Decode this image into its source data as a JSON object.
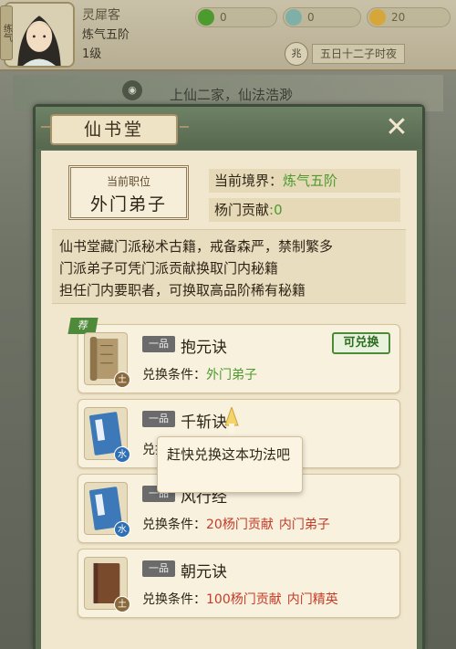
{
  "top_bar": {
    "side_tab": "练气",
    "player": {
      "name": "灵犀客",
      "realm": "炼气五阶",
      "level": "1级"
    },
    "resources": [
      {
        "icon": "spirit-stone-icon",
        "value": "0"
      },
      {
        "icon": "jade-icon",
        "value": "0"
      },
      {
        "icon": "coin-icon",
        "value": "20"
      }
    ],
    "time_badge": "兆",
    "time_text": "五日十二子时夜"
  },
  "news": {
    "text": "上仙二家，仙法浩渺"
  },
  "panel": {
    "title": "仙书堂",
    "close_icon": "close-icon",
    "rank": {
      "label": "当前职位",
      "value": "外门弟子"
    },
    "realm": {
      "label": "当前境界：",
      "value": "炼气五阶"
    },
    "contribution": {
      "label": "杨门贡献",
      "value": ":0"
    },
    "description": [
      "仙书堂藏门派秘术古籍，戒备森严，禁制繁多",
      "门派弟子可凭门派贡献换取门内秘籍",
      "担任门内要职者，可换取高品阶稀有秘籍"
    ],
    "items": [
      {
        "tag": "荐",
        "grade": "一品",
        "name": "抱元诀",
        "cond_label": "兑换条件：",
        "cond_green": "外门弟子",
        "cond_red1": "",
        "cond_red2": "",
        "button": "可兑换",
        "element": "土",
        "element_color": "#8a6a3c",
        "book_color": "#b29a6e"
      },
      {
        "tag": "",
        "grade": "一品",
        "name": "千斩诀",
        "cond_label": "兑换条件：",
        "cond_green": "",
        "cond_red1": "",
        "cond_red2": "",
        "button": "",
        "element": "水",
        "element_color": "#2f6fb3",
        "book_color": "#3d79b8"
      },
      {
        "tag": "",
        "grade": "一品",
        "name": "风行经",
        "cond_label": "兑换条件：",
        "cond_green": "",
        "cond_red1": "20杨门贡献",
        "cond_red2": "内门弟子",
        "button": "",
        "element": "水",
        "element_color": "#2f6fb3",
        "book_color": "#3d79b8"
      },
      {
        "tag": "",
        "grade": "一品",
        "name": "朝元诀",
        "cond_label": "兑换条件：",
        "cond_green": "",
        "cond_red1": "100杨门贡献",
        "cond_red2": "内门精英",
        "button": "",
        "element": "土",
        "element_color": "#8a6a3c",
        "book_color": "#7a4a2c"
      }
    ],
    "tooltip": "赶快兑换这本功法吧"
  }
}
